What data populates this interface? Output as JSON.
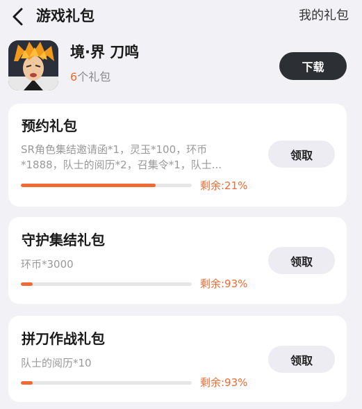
{
  "header": {
    "title": "游戏礼包",
    "my_gifts": "我的礼包"
  },
  "game": {
    "name": "境·界 刀鸣",
    "gift_count_num": "6",
    "gift_count_suffix": "个礼包",
    "download_label": "下载"
  },
  "gifts": [
    {
      "title": "预约礼包",
      "desc": "SR角色集结邀请函*1，灵玉*100，环币*1888，队士的阅历*2，召集令*1，队士...",
      "remain_label": "剩余:21%",
      "remain_fraction": 0.21,
      "claim_label": "领取"
    },
    {
      "title": "守护集结礼包",
      "desc": "环币*3000",
      "remain_label": "剩余:93%",
      "remain_fraction": 0.93,
      "claim_label": "领取"
    },
    {
      "title": "拼刀作战礼包",
      "desc": "队士的阅历*10",
      "remain_label": "剩余:93%",
      "remain_fraction": 0.93,
      "claim_label": "领取"
    }
  ],
  "colors": {
    "accent": "#ee6a32",
    "background": "#f2f2f6",
    "download_bg": "#2c2f33",
    "claim_bg": "#ececf2"
  },
  "icons": {
    "back": "chevron-left-icon",
    "game_avatar": "game-avatar-icon"
  }
}
